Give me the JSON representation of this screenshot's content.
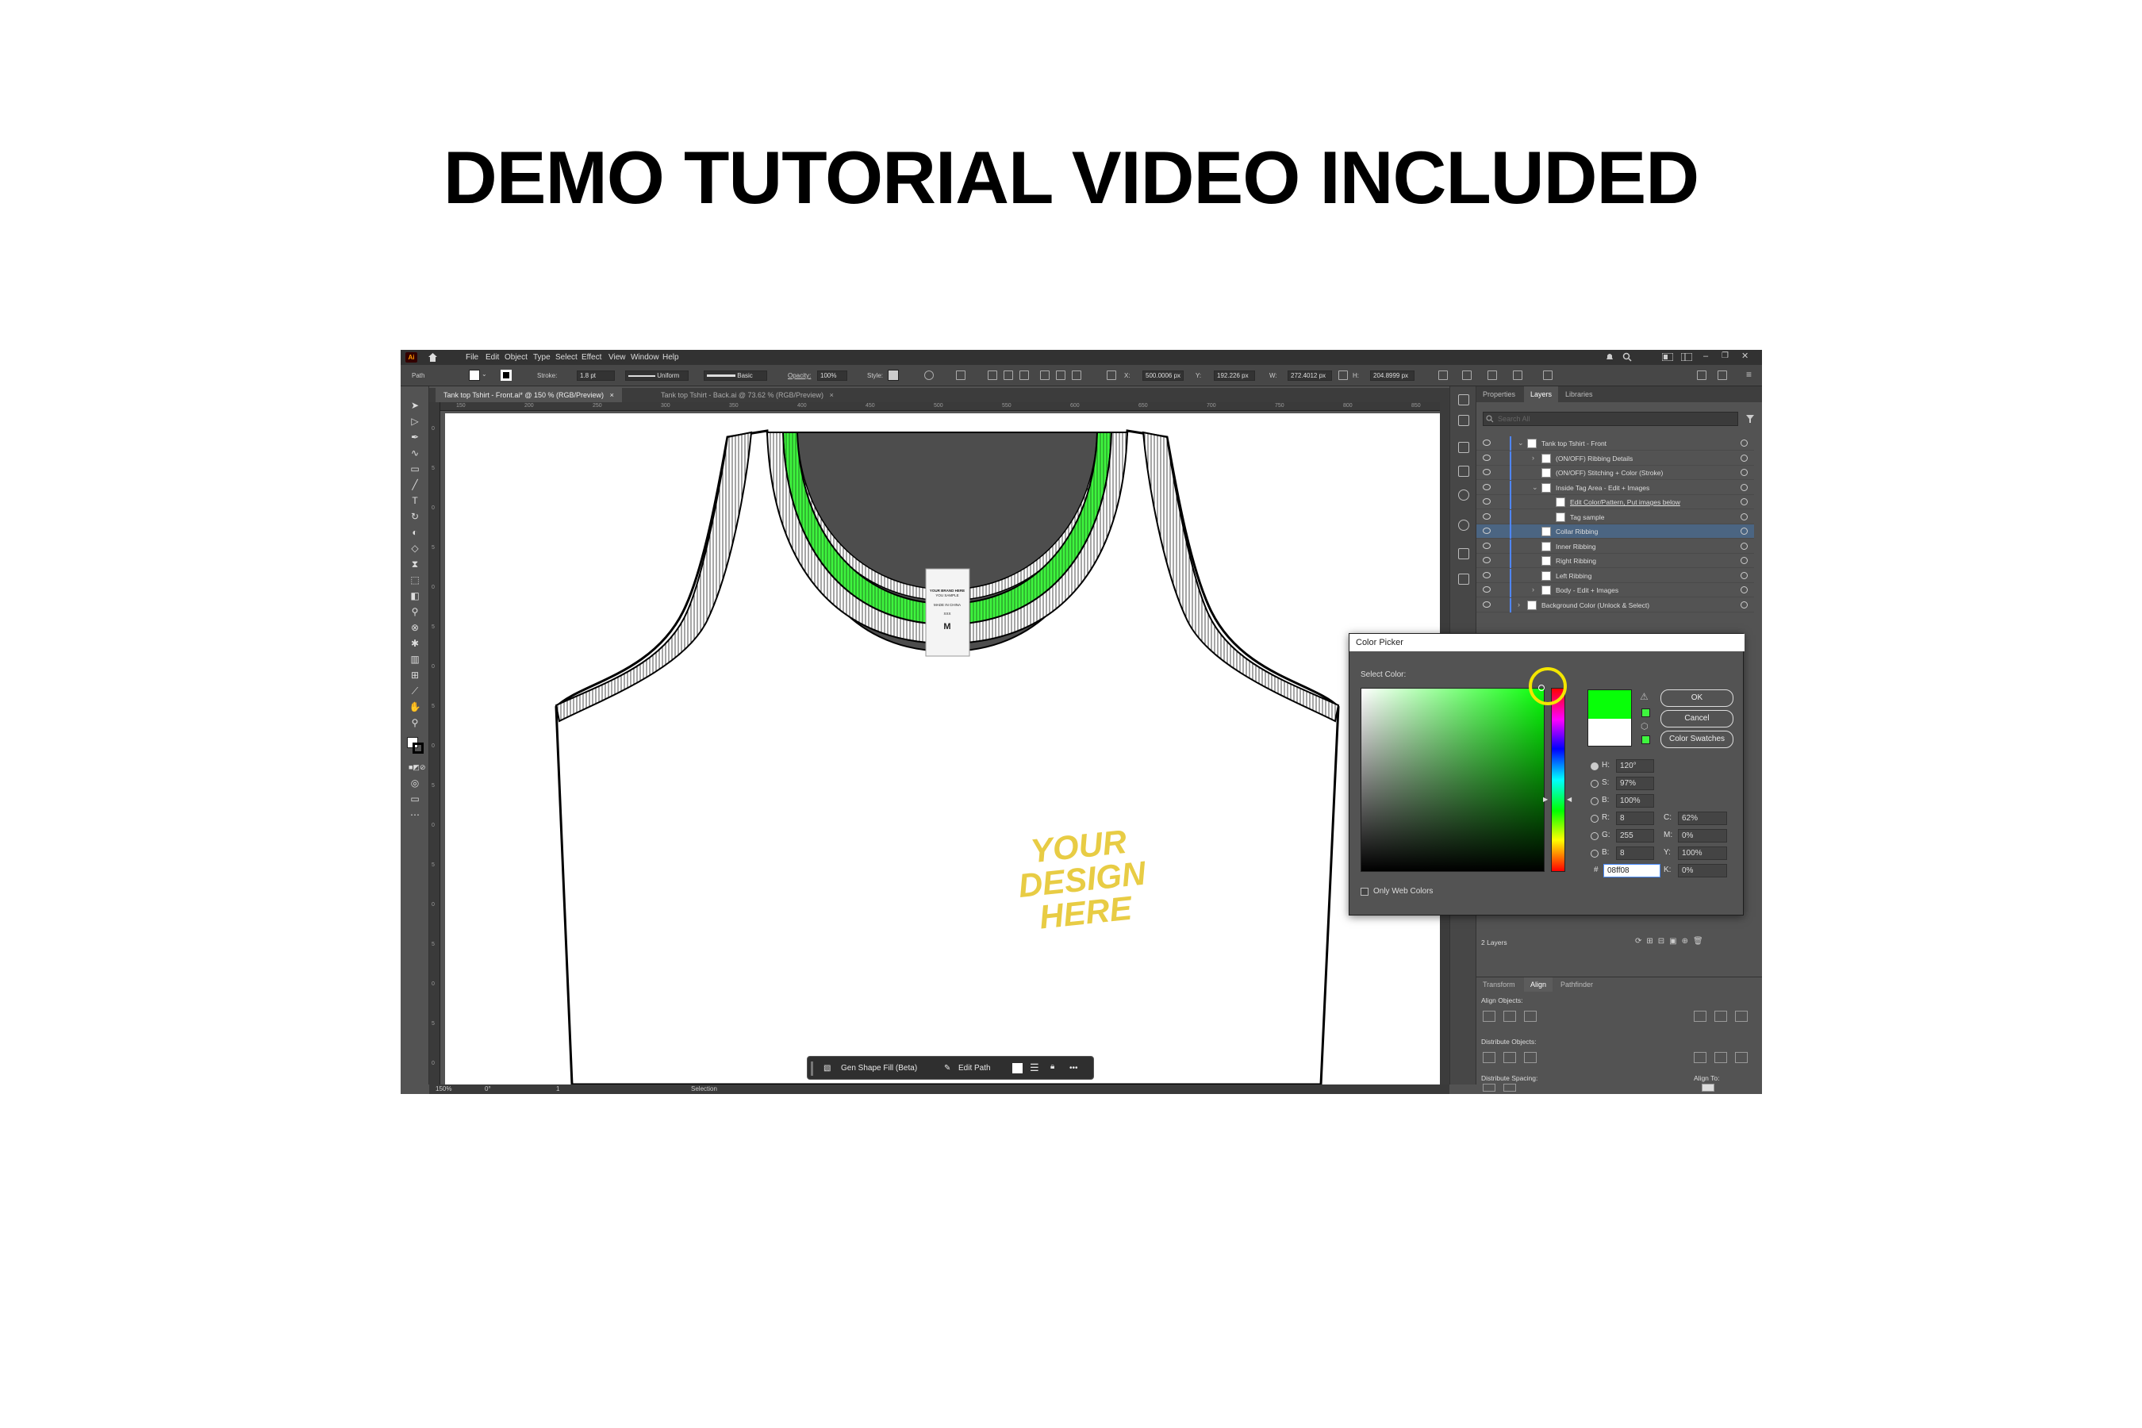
{
  "headline": "DEMO TUTORIAL VIDEO INCLUDED",
  "menu": [
    "File",
    "Edit",
    "Object",
    "Type",
    "Select",
    "Effect",
    "View",
    "Window",
    "Help"
  ],
  "control": {
    "path_label": "Path",
    "stroke_label": "Stroke:",
    "stroke_value": "1.8 pt",
    "uniform_label": "Uniform",
    "basic_label": "Basic",
    "opacity_label": "Opacity:",
    "opacity_value": "100%",
    "style_label": "Style:",
    "x_label": "X:",
    "x_value": "500.0006 px",
    "y_label": "Y:",
    "y_value": "192.226 px",
    "w_label": "W:",
    "w_value": "272.4012 px",
    "h_label": "H:",
    "h_value": "204.8999 px"
  },
  "tabs": [
    {
      "label": "Tank top Tshirt - Front.ai* @ 150 % (RGB/Preview)",
      "close": "×"
    },
    {
      "label": "Tank top Tshirt - Back.ai @ 73.62 % (RGB/Preview)",
      "close": "×"
    }
  ],
  "ruler_top": [
    "150",
    "200",
    "250",
    "300",
    "350",
    "400",
    "450",
    "500",
    "550",
    "600",
    "650",
    "700",
    "750",
    "800",
    "850"
  ],
  "ruler_left": [
    "0",
    "5",
    "0",
    "5",
    "0",
    "5",
    "0",
    "5",
    "0",
    "5",
    "0",
    "5",
    "0",
    "5",
    "0",
    "5",
    "0"
  ],
  "tag": {
    "line1": "YOUR BRAND HERE",
    "line2": "YOU SAMPLE",
    "line3": "MADE IN CHINA",
    "line4": "XXX",
    "size": "M"
  },
  "design_text": [
    "YOUR",
    "DESIGN",
    "HERE"
  ],
  "status": {
    "zoom": "150%",
    "angle": "0°",
    "page": "1",
    "tool": "Selection"
  },
  "floatbar": {
    "gen_fill": "Gen Shape Fill (Beta)",
    "edit_path": "Edit Path",
    "more": "•••"
  },
  "panel": {
    "tabs": [
      "Properties",
      "Layers",
      "Libraries"
    ],
    "search_placeholder": "Search All",
    "layers": [
      {
        "name": "Tank top Tshirt - Front",
        "indent": 0,
        "selected": false
      },
      {
        "name": "(ON/OFF) Ribbing Details",
        "indent": 1,
        "selected": false
      },
      {
        "name": "(ON/OFF) Stitching + Color (Stroke)",
        "indent": 1,
        "selected": false
      },
      {
        "name": "Inside Tag Area - Edit + Images",
        "indent": 1,
        "selected": false
      },
      {
        "name": "Edit Color/Pattern, Put images below",
        "indent": 2,
        "selected": false
      },
      {
        "name": "Tag sample",
        "indent": 2,
        "selected": false
      },
      {
        "name": "Collar Ribbing",
        "indent": 1,
        "selected": true
      },
      {
        "name": "Inner Ribbing",
        "indent": 1,
        "selected": false
      },
      {
        "name": "Right Ribbing",
        "indent": 1,
        "selected": false
      },
      {
        "name": "Left Ribbing",
        "indent": 1,
        "selected": false
      },
      {
        "name": "Body - Edit + Images",
        "indent": 1,
        "selected": false
      },
      {
        "name": "Background Color (Unlock & Select)",
        "indent": 0,
        "selected": false
      }
    ],
    "layers_count": "2 Layers",
    "bottom_tabs": [
      "Transform",
      "Align",
      "Pathfinder"
    ],
    "align_objects": "Align Objects:",
    "distribute_objects": "Distribute Objects:",
    "distribute_spacing": "Distribute Spacing:",
    "align_to": "Align To:"
  },
  "picker": {
    "title": "Color Picker",
    "select_color": "Select Color:",
    "ok": "OK",
    "cancel": "Cancel",
    "swatches": "Color Swatches",
    "h_label": "H:",
    "h_value": "120°",
    "s_label": "S:",
    "s_value": "97%",
    "b_label": "B:",
    "b_value": "100%",
    "r_label": "R:",
    "r_value": "8",
    "g_label": "G:",
    "g_value": "255",
    "bb_label": "B:",
    "bb_value": "8",
    "hex_label": "#",
    "hex_value": "08ff08",
    "c_label": "C:",
    "c_value": "62%",
    "m_label": "M:",
    "m_value": "0%",
    "y_label": "Y:",
    "y_value": "100%",
    "k_label": "K:",
    "k_value": "0%",
    "only_web": "Only Web Colors"
  },
  "colors": {
    "collar": "#3ef53e",
    "neck_inner": "#4d4d4d",
    "design": "#e8cc44",
    "selection": "#4b6582"
  }
}
